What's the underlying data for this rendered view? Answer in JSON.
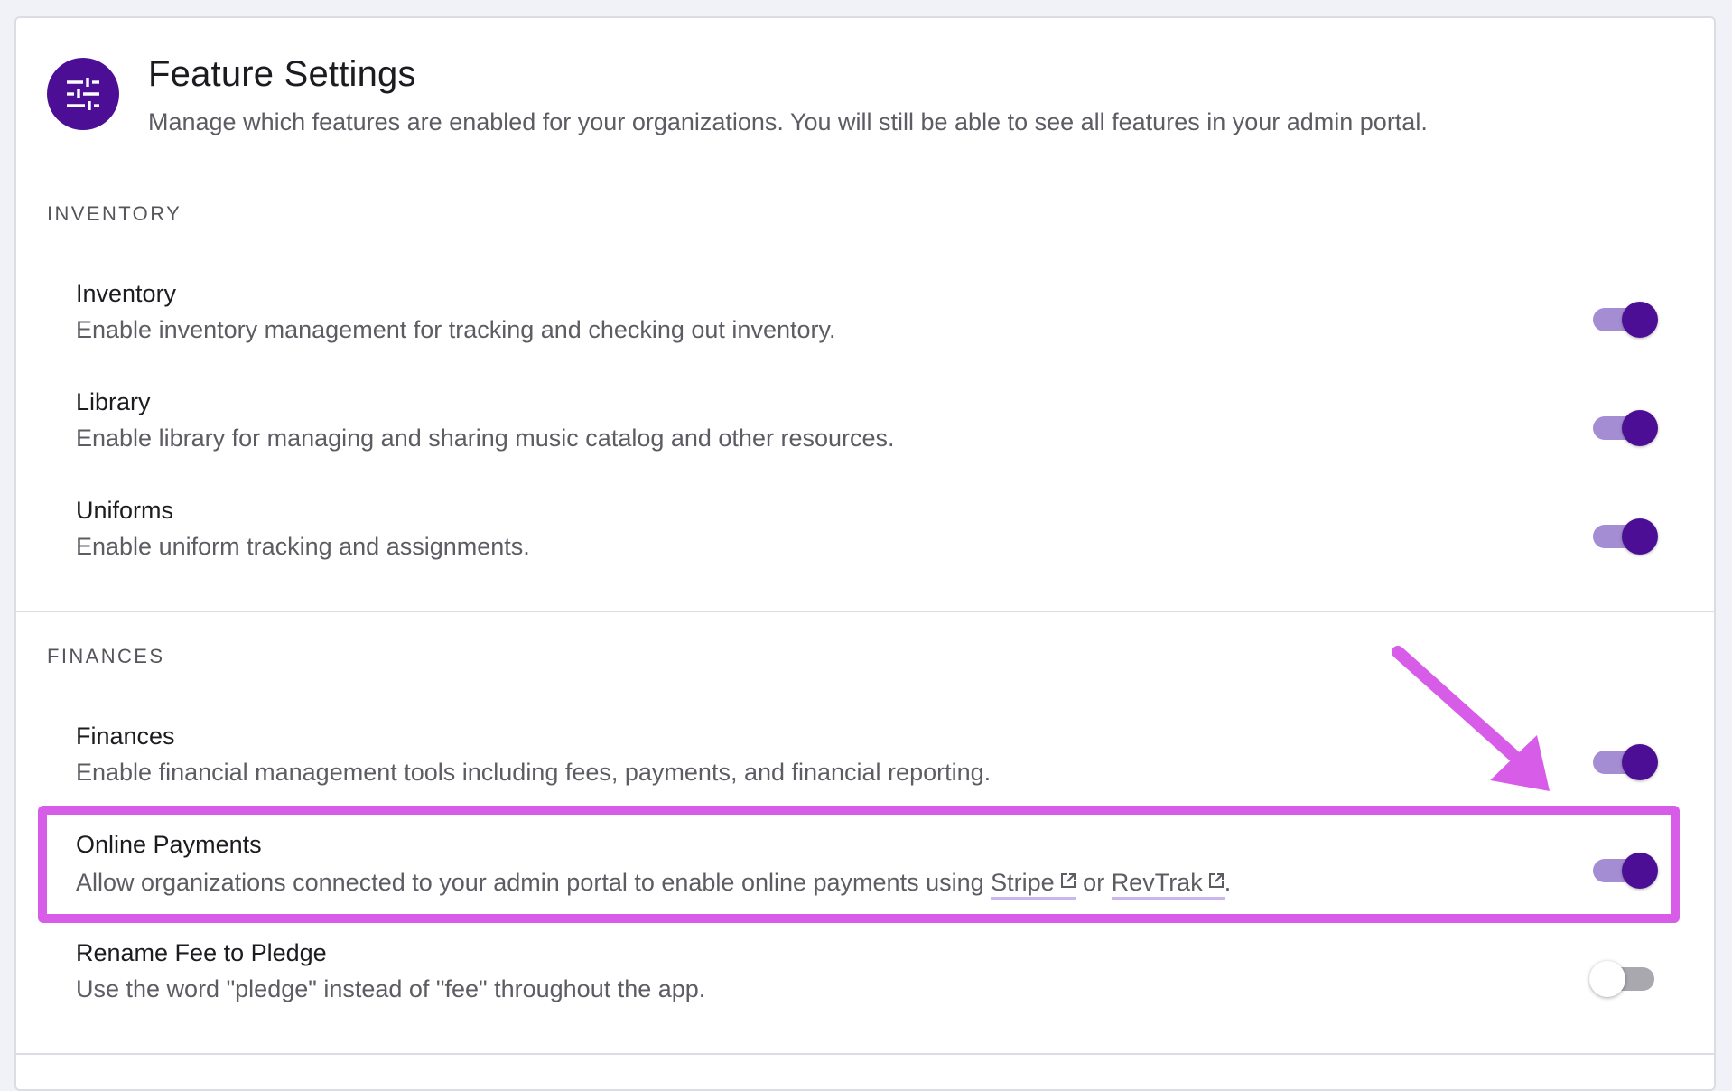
{
  "header": {
    "title": "Feature Settings",
    "subtitle": "Manage which features are enabled for your organizations. You will still be able to see all features in your admin portal.",
    "icon": "sliders-icon"
  },
  "sections": [
    {
      "label": "INVENTORY",
      "items": [
        {
          "title": "Inventory",
          "description": "Enable inventory management for tracking and checking out inventory.",
          "enabled": true
        },
        {
          "title": "Library",
          "description": "Enable library for managing and sharing music catalog and other resources.",
          "enabled": true
        },
        {
          "title": "Uniforms",
          "description": "Enable uniform tracking and assignments.",
          "enabled": true
        }
      ]
    },
    {
      "label": "FINANCES",
      "items": [
        {
          "title": "Finances",
          "description": "Enable financial management tools including fees, payments, and financial reporting.",
          "enabled": true
        },
        {
          "title": "Online Payments",
          "description_prefix": "Allow organizations connected to your admin portal to enable online payments using ",
          "link_1": "Stripe",
          "description_middle": " or ",
          "link_2": "RevTrak",
          "description_suffix": ".",
          "enabled": true
        },
        {
          "title": "Rename Fee to Pledge",
          "description": "Use the word \"pledge\" instead of \"fee\" throughout the app.",
          "enabled": false
        }
      ]
    }
  ],
  "colors": {
    "accent": "#4d0e96",
    "toggle_track_on": "#a48dd2",
    "annotation": "#d75de8"
  }
}
